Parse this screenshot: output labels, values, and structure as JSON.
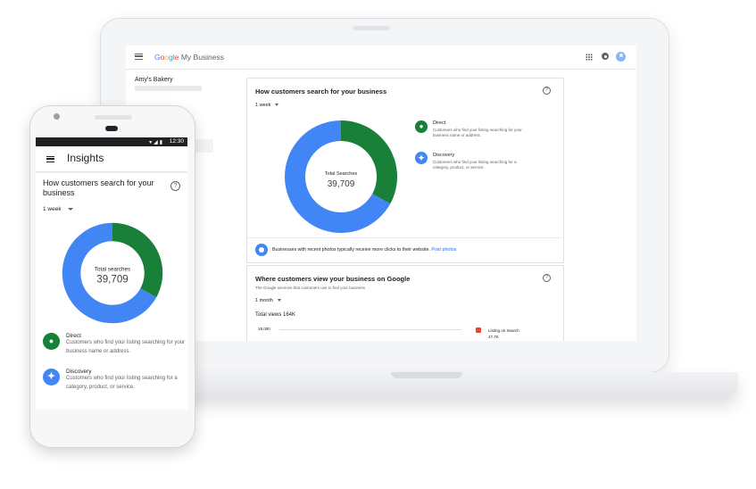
{
  "colors": {
    "direct": "#188038",
    "discovery": "#4285f4",
    "link": "#1a73e8"
  },
  "desktop": {
    "app": {
      "logo_google": "Google",
      "logo_product": "My Business"
    },
    "business_name": "Amy's Bakery",
    "icons": [
      "menu-icon",
      "apps-icon",
      "notifications-icon",
      "account-avatar"
    ],
    "search_card": {
      "title": "How customers search for your business",
      "range": "1 week",
      "center_label": "Total Searches",
      "center_value": "39,709",
      "legend": [
        {
          "title": "Direct",
          "desc": "Customers who find your listing searching for your business name or address.",
          "icon": "location-pin-icon"
        },
        {
          "title": "Discovery",
          "desc": "Customers who find your listing searching for a category, product, or service.",
          "icon": "discover-icon"
        }
      ],
      "photo_tip": "Businesses with recent photos typically receive more clicks to their website.",
      "photo_link": "Post photos"
    },
    "views_card": {
      "title": "Where customers view your business on Google",
      "subtitle": "The Google services that customers use to find your business",
      "range": "1 month",
      "total_views": "Total views 164K",
      "tick": "18,000",
      "legend_label": "Listing on Search",
      "legend_value": "47.7K"
    }
  },
  "mobile": {
    "status_time": "12:30",
    "app_title": "Insights",
    "card_title": "How customers search for your business",
    "range": "1 week",
    "center_label": "Total searches",
    "center_value": "39,709",
    "legend": [
      {
        "title": "Direct",
        "desc": "Customers who find your listing searching for your business name or address."
      },
      {
        "title": "Discovery",
        "desc": "Customers who find your listing searching for a category, product, or service."
      }
    ]
  },
  "chart_data": {
    "type": "pie",
    "title": "How customers search for your business",
    "categories": [
      "Direct",
      "Discovery"
    ],
    "values": [
      33,
      67
    ],
    "total_label": "Total searches",
    "total": 39709
  }
}
